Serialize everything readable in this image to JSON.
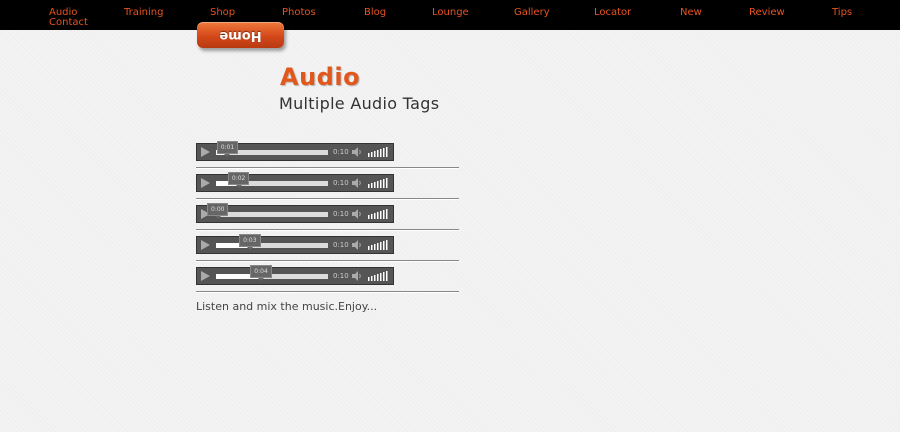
{
  "nav": {
    "items": [
      {
        "label": "Audio"
      },
      {
        "label": "Training"
      },
      {
        "label": "Shop"
      },
      {
        "label": "Photos"
      },
      {
        "label": "Blog"
      },
      {
        "label": "Lounge"
      },
      {
        "label": "Gallery"
      },
      {
        "label": "Locator"
      },
      {
        "label": "New"
      },
      {
        "label": "Review"
      },
      {
        "label": "Tips"
      },
      {
        "label": "Contact"
      }
    ],
    "link_color": "#e8531f",
    "background_color": "#000000"
  },
  "home_button": {
    "label": "Home",
    "mirrored": true
  },
  "page": {
    "title": "Audio",
    "subtitle": "Multiple Audio Tags",
    "title_color": "#e0581c"
  },
  "players": [
    {
      "current_time": "0:01",
      "duration": "0:10",
      "progress": 0.1
    },
    {
      "current_time": "0:02",
      "duration": "0:10",
      "progress": 0.2
    },
    {
      "current_time": "0:00",
      "duration": "0:10",
      "progress": 0.0
    },
    {
      "current_time": "0:03",
      "duration": "0:10",
      "progress": 0.3
    },
    {
      "current_time": "0:04",
      "duration": "0:10",
      "progress": 0.4
    }
  ],
  "footer": {
    "text": "Listen and mix the music.Enjoy..."
  }
}
